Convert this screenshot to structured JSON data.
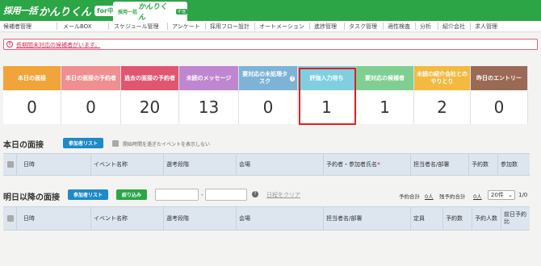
{
  "header": {
    "logo_text_1": "採用一括",
    "logo_text_2": "かんりくん",
    "logo_badge": "for中途",
    "product_tab": {
      "small": "採用一括",
      "main": "かんりくん",
      "badge": "中途"
    }
  },
  "nav": [
    "候補者管理",
    "メールBOX",
    "スケジュール管理",
    "アンケート",
    "採用フロー設計",
    "オートメーション",
    "進捗管理",
    "タスク管理",
    "適性検査",
    "分析",
    "紹介会社",
    "求人管理"
  ],
  "alert": {
    "text": "長期間未対応の候補者がいます。"
  },
  "stats": [
    {
      "label": "本日の面接",
      "value": "0",
      "color": "#f0a43a"
    },
    {
      "label": "本日の面接の予約者",
      "value": "0",
      "color": "#ef8f8f"
    },
    {
      "label": "過去の面接の予約者",
      "value": "20",
      "color": "#e0566e"
    },
    {
      "label": "未読のメッセージ",
      "value": "13",
      "color": "#bf87cf"
    },
    {
      "label": "要対応の未処理タスク",
      "value": "0",
      "color": "#7eb3d8"
    },
    {
      "label": "評価入力待ち",
      "value": "1",
      "color": "#7fcfe0"
    },
    {
      "label": "要対応の候補者",
      "value": "1",
      "color": "#7fcf92"
    },
    {
      "label": "未読の紹介会社とのやりとり",
      "value": "2",
      "color": "#f3b941"
    },
    {
      "label": "昨日のエントリー",
      "value": "0",
      "color": "#9a6a54"
    }
  ],
  "today": {
    "title": "本日の面接",
    "participants_button": "参加者リスト",
    "hide_past_label": "開始時間を過ぎたイベントを表示しない",
    "columns": [
      "日時",
      "イベント名称",
      "選考段階",
      "会場",
      "予約者・参加者氏名",
      "担当者名/部署",
      "予約数",
      "参加数"
    ]
  },
  "future": {
    "title": "明日以降の面接",
    "participants_button": "参加者リスト",
    "filter_button": "絞り込み",
    "date_from": "",
    "date_to": "",
    "date_separator": "-",
    "clear_date": "日程をクリア",
    "total_reservations_label": "予約合計",
    "total_reservations_value": "0人",
    "remaining_label": "残予約合計",
    "remaining_value": "0人",
    "page_size": "20件",
    "pagination": "1/0",
    "columns": [
      "日時",
      "イベント名称",
      "選考段階",
      "会場",
      "担当者名/部署",
      "定員",
      "予約数",
      "予約人数",
      "前日予約比"
    ]
  }
}
